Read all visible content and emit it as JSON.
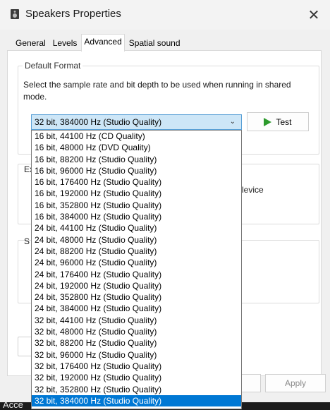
{
  "window": {
    "title": "Speakers Properties",
    "close_glyph": "✕"
  },
  "tabs": [
    {
      "label": "General",
      "active": false
    },
    {
      "label": "Levels",
      "active": false
    },
    {
      "label": "Advanced",
      "active": true
    },
    {
      "label": "Spatial sound",
      "active": false
    }
  ],
  "default_format": {
    "group_title": "Default Format",
    "description": "Select the sample rate and bit depth to be used when running in shared mode.",
    "selected_value": "32 bit, 384000 Hz (Studio Quality)",
    "test_label": "Test"
  },
  "dropdown_options": [
    "16 bit, 44100 Hz (CD Quality)",
    "16 bit, 48000 Hz (DVD Quality)",
    "16 bit, 88200 Hz (Studio Quality)",
    "16 bit, 96000 Hz (Studio Quality)",
    "16 bit, 176400 Hz (Studio Quality)",
    "16 bit, 192000 Hz (Studio Quality)",
    "16 bit, 352800 Hz (Studio Quality)",
    "16 bit, 384000 Hz (Studio Quality)",
    "24 bit, 44100 Hz (Studio Quality)",
    "24 bit, 48000 Hz (Studio Quality)",
    "24 bit, 88200 Hz (Studio Quality)",
    "24 bit, 96000 Hz (Studio Quality)",
    "24 bit, 176400 Hz (Studio Quality)",
    "24 bit, 192000 Hz (Studio Quality)",
    "24 bit, 352800 Hz (Studio Quality)",
    "24 bit, 384000 Hz (Studio Quality)",
    "32 bit, 44100 Hz (Studio Quality)",
    "32 bit, 48000 Hz (Studio Quality)",
    "32 bit, 88200 Hz (Studio Quality)",
    "32 bit, 96000 Hz (Studio Quality)",
    "32 bit, 176400 Hz (Studio Quality)",
    "32 bit, 192000 Hz (Studio Quality)",
    "32 bit, 352800 Hz (Studio Quality)",
    "32 bit, 384000 Hz (Studio Quality)"
  ],
  "selected_index": 23,
  "hidden_fragments": {
    "exclusive_group_partial": "Ex",
    "device_partial": "levice",
    "signal_group_partial": "S"
  },
  "buttons": {
    "apply_label": "Apply"
  },
  "taskbar": {
    "partial_text": "Acce"
  },
  "colors": {
    "selection": "#0078d4",
    "select_bg": "#cde6f7",
    "play_icon": "#2c9a2c"
  }
}
